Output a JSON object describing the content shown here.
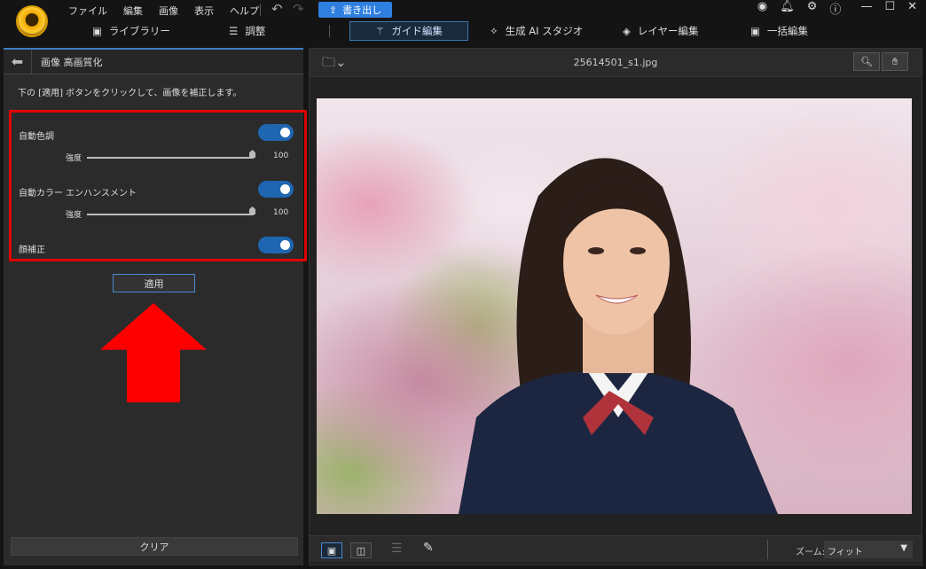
{
  "menu": [
    "ファイル",
    "編集",
    "画像",
    "表示",
    "ヘルプ"
  ],
  "export_label": "書き出し",
  "tabs": [
    {
      "label": "ライブラリー"
    },
    {
      "label": "調整"
    },
    {
      "label": "ガイド編集",
      "active": true
    },
    {
      "label": "生成 AI スタジオ"
    },
    {
      "label": "レイヤー編集"
    },
    {
      "label": "一括編集"
    }
  ],
  "panel": {
    "title": "画像 高画質化",
    "instruction": "下の [適用] ボタンをクリックして、画像を補正します。",
    "options": [
      {
        "label": "自動色調",
        "enabled": true,
        "strength_label": "強度",
        "strength": 100
      },
      {
        "label": "自動カラー エンハンスメント",
        "enabled": true,
        "strength_label": "強度",
        "strength": 100
      },
      {
        "label": "顔補正",
        "enabled": true
      }
    ],
    "apply_label": "適用",
    "clear_label": "クリア"
  },
  "viewer": {
    "filename": "25614501_s1.jpg",
    "zoom_label": "ズーム:",
    "zoom_value": "フィット"
  },
  "colors": {
    "accent": "#2f7fe0",
    "toggle": "#1e66b0",
    "highlight": "#e00000"
  }
}
